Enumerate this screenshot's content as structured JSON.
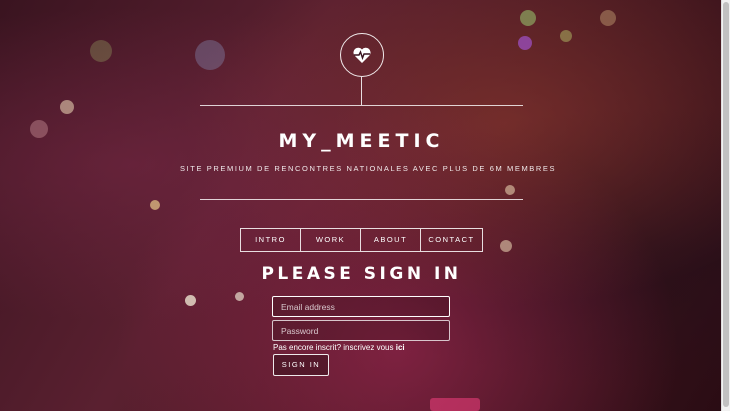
{
  "brand": {
    "title": "MY_MEETIC",
    "tagline": "SITE PREMIUM DE RENCONTRES NATIONALES AVEC PLUS DE 6M MEMBRES"
  },
  "nav": {
    "items": [
      {
        "label": "INTRO"
      },
      {
        "label": "WORK"
      },
      {
        "label": "ABOUT"
      },
      {
        "label": "CONTACT"
      }
    ]
  },
  "login": {
    "title": "PLEASE SIGN IN",
    "email_placeholder": "Email address",
    "password_placeholder": "Password",
    "register_text": "Pas encore inscrit? inscrivez vous ",
    "register_link": "ici",
    "submit_label": "SIGN IN"
  },
  "icons": {
    "logo": "heart-pulse-icon"
  },
  "colors": {
    "accent": "#ffffff",
    "background": "#3a1420"
  }
}
